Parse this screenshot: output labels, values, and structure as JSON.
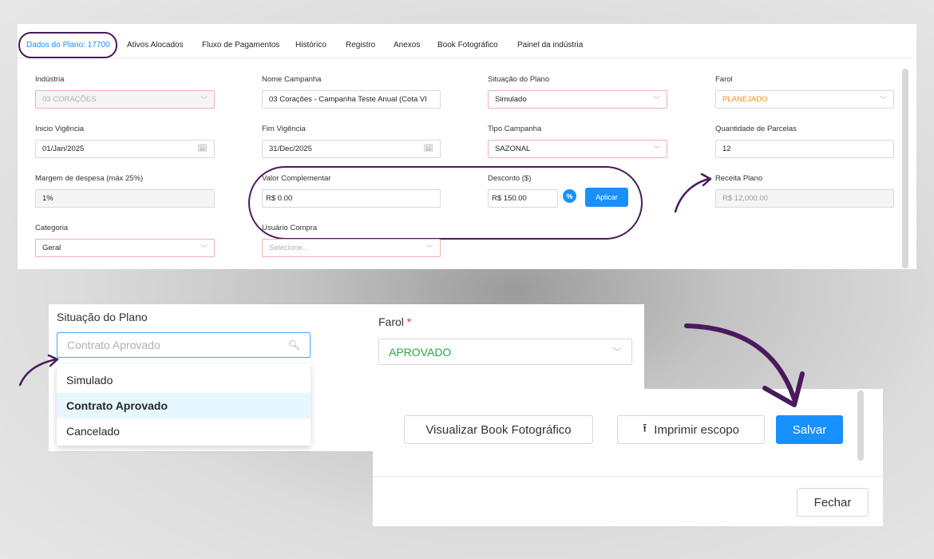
{
  "tabs": [
    {
      "label": "Dados do Plano: 17700"
    },
    {
      "label": "Ativos Alocados"
    },
    {
      "label": "Fluxo de Pagamentos"
    },
    {
      "label": "Histórico"
    },
    {
      "label": "Registro"
    },
    {
      "label": "Anexos"
    },
    {
      "label": "Book Fotográfico"
    },
    {
      "label": "Painel da indústria"
    }
  ],
  "form": {
    "industria": {
      "label": "Indústria",
      "value": "03 CORAÇÕES"
    },
    "nome_campanha": {
      "label": "Nome Campanha",
      "value": "03 Corações - Campanha Teste Anual  (Cota VI"
    },
    "situacao": {
      "label": "Situação do Plano",
      "value": "Simulado"
    },
    "farol": {
      "label": "Farol",
      "value": "PLANEJADO"
    },
    "inicio": {
      "label": "Inicio Vigência",
      "value": "01/Jan/2025"
    },
    "fim": {
      "label": "Fim Vigência",
      "value": "31/Dec/2025"
    },
    "tipo": {
      "label": "Tipo Campanha",
      "value": "SAZONAL"
    },
    "parcelas": {
      "label": "Quantidade de Parcelas",
      "value": "12"
    },
    "margem": {
      "label": "Margem de despesa (máx 25%)",
      "value": "1%"
    },
    "valor_comp": {
      "label": "Valor Complementar",
      "value": "R$ 0.00"
    },
    "desconto": {
      "label": "Desconto ($)",
      "value": "R$ 150.00"
    },
    "pct_icon": "%",
    "aplicar": "Aplicar",
    "receita": {
      "label": "Receita Plano",
      "value": "R$ 12,000.00"
    },
    "categoria": {
      "label": "Categoria",
      "value": "Geral"
    },
    "usuario": {
      "label": "Usuário Compra",
      "placeholder": "Selecione..."
    }
  },
  "zoom_situacao": {
    "label": "Situação do Plano",
    "search_value": "Contrato Aprovado",
    "options": [
      "Simulado",
      "Contrato Aprovado",
      "Cancelado"
    ],
    "selected_index": 1
  },
  "zoom_farol": {
    "label": "Farol",
    "required_mark": "*",
    "value": "APROVADO"
  },
  "actions": {
    "book": "Visualizar Book Fotográfico",
    "imprimir": "Imprimir escopo",
    "salvar": "Salvar",
    "fechar": "Fechar"
  },
  "colors": {
    "accent": "#1890ff",
    "highlight_ring": "#4a1a5c",
    "farol_warning": "#fa8c16",
    "farol_ok": "#28a745",
    "error_border": "#f1b0b7"
  },
  "icons": [
    "chevron-down-icon",
    "calendar-icon",
    "percent-icon",
    "search-icon",
    "upload-icon"
  ]
}
